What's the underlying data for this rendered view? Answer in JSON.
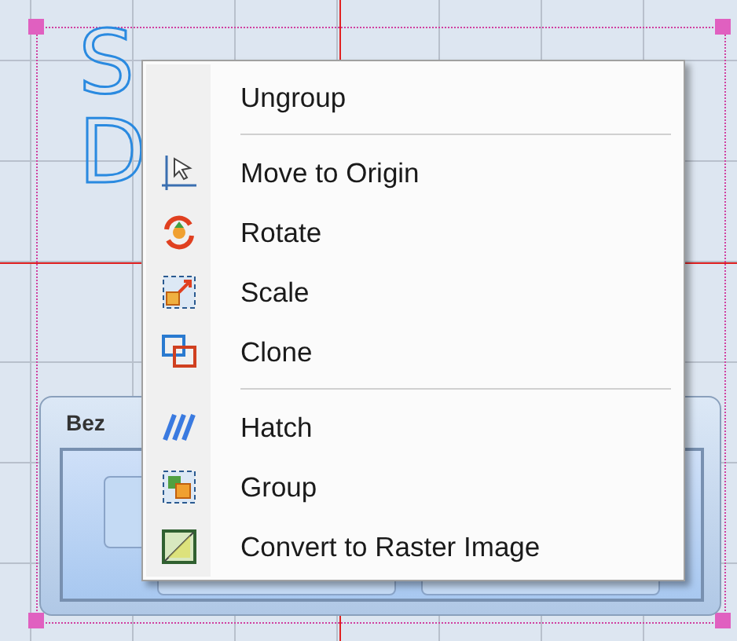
{
  "canvas": {
    "outline_text": [
      "S",
      "D"
    ],
    "panel": {
      "title": "Bez"
    }
  },
  "context_menu": {
    "items": [
      {
        "kind": "item",
        "label": "Ungroup"
      },
      {
        "kind": "separator"
      },
      {
        "kind": "item",
        "label": "Move to Origin"
      },
      {
        "kind": "item",
        "label": "Rotate"
      },
      {
        "kind": "item",
        "label": "Scale"
      },
      {
        "kind": "item",
        "label": "Clone"
      },
      {
        "kind": "separator"
      },
      {
        "kind": "item",
        "label": "Hatch"
      },
      {
        "kind": "item",
        "label": "Group"
      },
      {
        "kind": "item",
        "label": "Convert to Raster Image"
      }
    ]
  }
}
